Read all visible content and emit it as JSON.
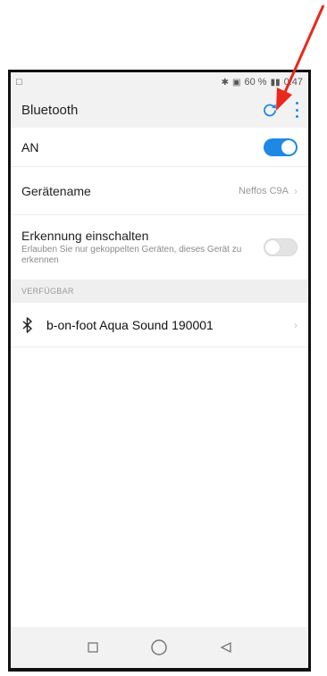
{
  "status_bar": {
    "left_icon": "notification-icon",
    "bluetooth_icon": "bluetooth-icon",
    "battery_percent": "60 %",
    "time": "0:47"
  },
  "app_bar": {
    "title": "Bluetooth",
    "refresh_icon": "refresh-icon",
    "menu_icon": "more-vert-icon",
    "accent_color": "#1e88e5"
  },
  "settings": {
    "on_label": "AN",
    "on_state": true,
    "device_name_label": "Gerätename",
    "device_name_value": "Neffos C9A",
    "discovery_label": "Erkennung einschalten",
    "discovery_desc": "Erlauben Sie nur gekoppelten Geräten, dieses Gerät zu erkennen",
    "discovery_state": false
  },
  "available": {
    "header": "VERFÜGBAR",
    "devices": [
      {
        "name": "b-on-foot Aqua Sound 190001",
        "icon": "bluetooth-icon"
      }
    ]
  },
  "nav_bar": {
    "recents_icon": "square-icon",
    "home_icon": "circle-icon",
    "back_icon": "triangle-back-icon"
  },
  "annotation": {
    "arrow_color": "#e8291c"
  }
}
